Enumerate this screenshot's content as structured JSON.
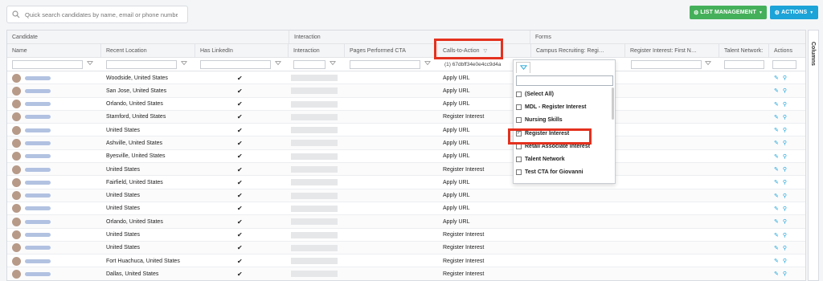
{
  "search": {
    "placeholder": "Quick search candidates by name, email or phone number"
  },
  "toolbar": {
    "list_management": "LIST MANAGEMENT",
    "actions": "ACTIONS"
  },
  "groups": {
    "candidate": "Candidate",
    "interaction": "Interaction",
    "forms": "Forms"
  },
  "columns": {
    "name": "Name",
    "recent_location": "Recent Location",
    "has_linkedin": "Has LinkedIn",
    "interaction": "Interaction",
    "pages_cta": "Pages Performed CTA",
    "calls_to_action": "Calls-to-Action",
    "campus": "Campus Recruiting: Regi…",
    "register_interest": "Register Interest: First N…",
    "talent_network": "Talent Network:",
    "actions": "Actions"
  },
  "filter": {
    "cta_value": "(1) 67dbff34e0e4cc9d4a"
  },
  "side_tab": "Columns",
  "rows": [
    {
      "location": "Woodside, United States",
      "linkedin": "✔",
      "cta": "Apply URL"
    },
    {
      "location": "San Jose, United States",
      "linkedin": "✔",
      "cta": "Apply URL"
    },
    {
      "location": "Orlando, United States",
      "linkedin": "✔",
      "cta": "Apply URL"
    },
    {
      "location": "Stamford, United States",
      "linkedin": "✔",
      "cta": "Register Interest"
    },
    {
      "location": "United States",
      "linkedin": "✔",
      "cta": "Apply URL"
    },
    {
      "location": "Ashville, United States",
      "linkedin": "✔",
      "cta": "Apply URL"
    },
    {
      "location": "Byesville, United States",
      "linkedin": "✔",
      "cta": "Apply URL"
    },
    {
      "location": "United States",
      "linkedin": "✔",
      "cta": "Register Interest"
    },
    {
      "location": "Fairfield, United States",
      "linkedin": "✔",
      "cta": "Apply URL"
    },
    {
      "location": "United States",
      "linkedin": "✔",
      "cta": "Apply URL"
    },
    {
      "location": "United States",
      "linkedin": "✔",
      "cta": "Apply URL"
    },
    {
      "location": "Orlando, United States",
      "linkedin": "✔",
      "cta": "Apply URL"
    },
    {
      "location": "United States",
      "linkedin": "✔",
      "cta": "Register Interest"
    },
    {
      "location": "United States",
      "linkedin": "✔",
      "cta": "Register Interest"
    },
    {
      "location": "Fort Huachuca, United States",
      "linkedin": "✔",
      "cta": "Register Interest"
    },
    {
      "location": "Dallas, United States",
      "linkedin": "✔",
      "cta": "Register Interest"
    }
  ],
  "dropdown": {
    "items": [
      {
        "label": "(Select All)",
        "checked": false
      },
      {
        "label": "MDL - Register Interest",
        "checked": false
      },
      {
        "label": "Nursing Skills",
        "checked": false
      },
      {
        "label": "Register Interest",
        "checked": true
      },
      {
        "label": "Retail Associate Interest",
        "checked": false
      },
      {
        "label": "Talent Network",
        "checked": false
      },
      {
        "label": "Test CTA for Giovanni",
        "checked": false
      }
    ]
  },
  "colors": {
    "accent_green": "#45b05a",
    "accent_blue": "#1ca3d8",
    "highlight_red": "#e4311e"
  }
}
